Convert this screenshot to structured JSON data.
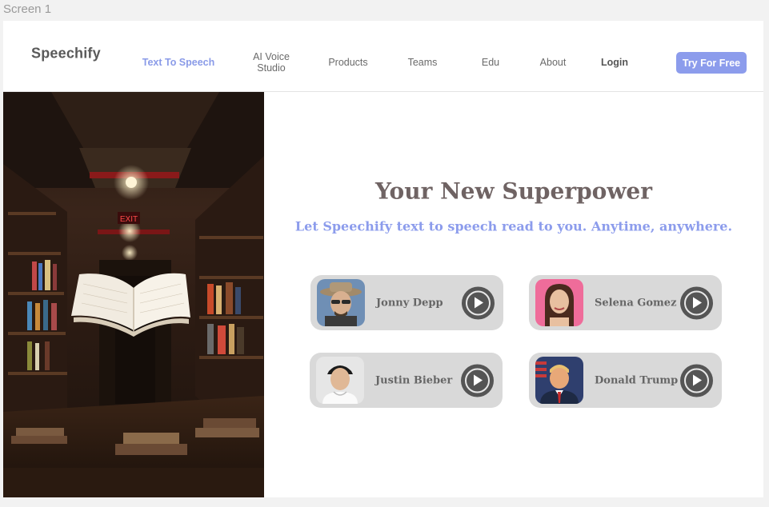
{
  "frame": {
    "label": "Screen 1"
  },
  "nav": {
    "brand": "Speechify",
    "links": [
      {
        "label": "Text To Speech"
      },
      {
        "label": "AI Voice Studio"
      },
      {
        "label": "Products"
      },
      {
        "label": "Teams"
      },
      {
        "label": "Edu"
      },
      {
        "label": "About"
      },
      {
        "label": "Login"
      }
    ],
    "cta": "Try For Free"
  },
  "hero": {
    "image_icon": "library-floating-book-photo",
    "title": "Your New Superpower",
    "subtitle": "Let Speechify text to speech read to you. Anytime, anywhere."
  },
  "voices": [
    {
      "name": "Jonny Depp",
      "avatar_icon": "portrait-hat-icon",
      "avatar_bg": "#6f8fb5"
    },
    {
      "name": "Selena Gomez",
      "avatar_icon": "portrait-woman-icon",
      "avatar_bg": "#ef6c9a"
    },
    {
      "name": "Justin Bieber",
      "avatar_icon": "portrait-cap-icon",
      "avatar_bg": "#e6e6e6"
    },
    {
      "name": "Donald Trump",
      "avatar_icon": "portrait-flag-icon",
      "avatar_bg": "#2f3f6e"
    }
  ],
  "colors": {
    "accent": "#8c9cec",
    "headline": "#6f6363",
    "card": "#d9d9d9",
    "play": "#555555"
  },
  "icons": {
    "play": "play-icon"
  }
}
